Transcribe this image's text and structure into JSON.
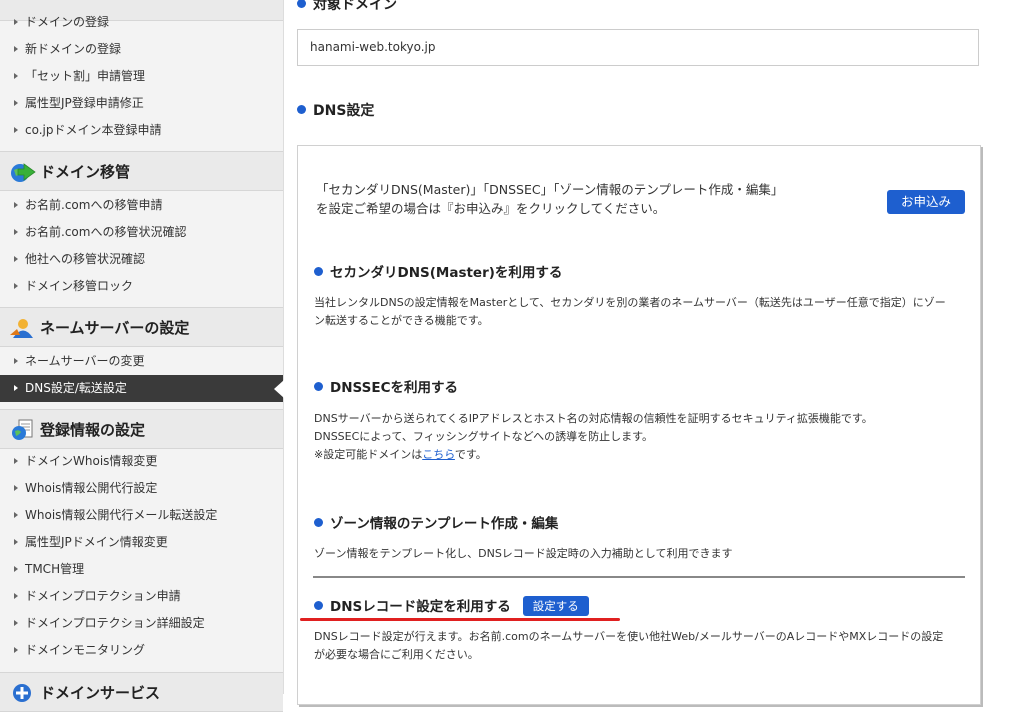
{
  "sidebar": {
    "top_items": [
      "ドメインの登録",
      "新ドメインの登録",
      "「セット割」申請管理",
      "属性型JP登録申請修正",
      "co.jpドメイン本登録申請"
    ],
    "sections": [
      {
        "title": "ドメイン移管",
        "icon": "globe-arrow-icon",
        "items": [
          "お名前.comへの移管申請",
          "お名前.comへの移管状況確認",
          "他社への移管状況確認",
          "ドメイン移管ロック"
        ]
      },
      {
        "title": "ネームサーバーの設定",
        "icon": "person-icon",
        "items": [
          "ネームサーバーの変更",
          "DNS設定/転送設定"
        ]
      },
      {
        "title": "登録情報の設定",
        "icon": "document-globe-icon",
        "items": [
          "ドメインWhois情報変更",
          "Whois情報公開代行設定",
          "Whois情報公開代行メール転送設定",
          "属性型JPドメイン情報変更",
          "TMCH管理",
          "ドメインプロテクション申請",
          "ドメインプロテクション詳細設定",
          "ドメインモニタリング"
        ]
      },
      {
        "title": "ドメインサービス",
        "icon": "plus-circle-icon",
        "items": []
      }
    ],
    "active_item": "DNS設定/転送設定"
  },
  "main": {
    "target_domain_title": "対象ドメイン",
    "domain_value": "hanami-web.tokyo.jp",
    "dns_settings_title": "DNS設定",
    "intro_text": "「セカンダリDNS(Master)」「DNSSEC」「ゾーン情報のテンプレート作成・編集」を設定ご希望の場合は『お申込み』をクリックしてください。",
    "apply_button": "お申込み",
    "secondary": {
      "title": "セカンダリDNS(Master)を利用する",
      "desc": "当社レンタルDNSの設定情報をMasterとして、セカンダリを別の業者のネームサーバー（転送先はユーザー任意で指定）にゾーン転送することができる機能です。"
    },
    "dnssec": {
      "title": "DNSSECを利用する",
      "desc1": "DNSサーバーから送られてくるIPアドレスとホスト名の対応情報の信頼性を証明するセキュリティ拡張機能です。",
      "desc2": "DNSSECによって、フィッシングサイトなどへの誘導を防止します。",
      "note_prefix": "※設定可能ドメインは",
      "note_link": "こちら",
      "note_suffix": "です。"
    },
    "zone": {
      "title": "ゾーン情報のテンプレート作成・編集",
      "desc": "ゾーン情報をテンプレート化し、DNSレコード設定時の入力補助として利用できます"
    },
    "dns_record": {
      "title": "DNSレコード設定を利用する",
      "button": "設定する",
      "desc": "DNSレコード設定が行えます。お名前.comのネームサーバーを使い他社Web/メールサーバーのAレコードやMXレコードの設定が必要な場合にご利用ください。"
    }
  }
}
